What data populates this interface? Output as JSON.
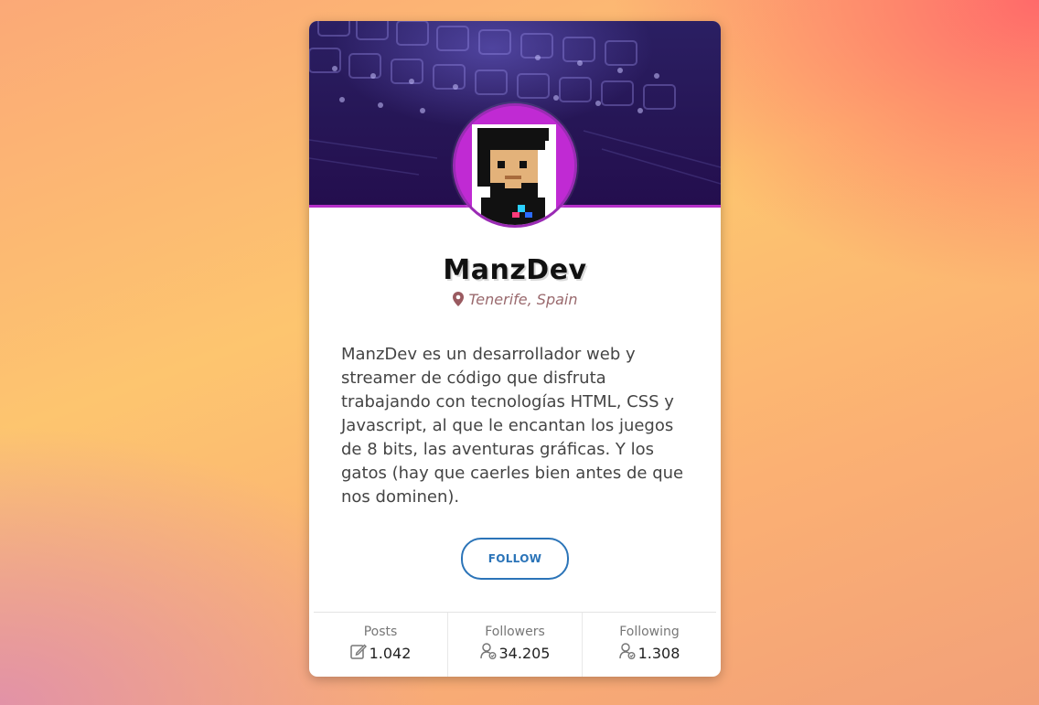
{
  "profile": {
    "name": "ManzDev",
    "location": "Tenerife, Spain",
    "bio": "ManzDev es un desarrollador web y streamer de código que disfruta trabajando con tecnologías HTML, CSS y Javascript, al que le encantan los juegos de 8 bits, las aventuras gráficas. Y los gatos (hay que caerles bien antes de que nos dominen).",
    "follow_label": "FOLLOW"
  },
  "stats": [
    {
      "label": "Posts",
      "value": "1.042",
      "icon": "edit-icon"
    },
    {
      "label": "Followers",
      "value": "34.205",
      "icon": "user-icon"
    },
    {
      "label": "Following",
      "value": "1.308",
      "icon": "user-icon"
    }
  ],
  "colors": {
    "accent": "#2b74b8",
    "banner": "#261656",
    "avatar_ring": "#c02ad3",
    "location": "#9a6a6e"
  }
}
